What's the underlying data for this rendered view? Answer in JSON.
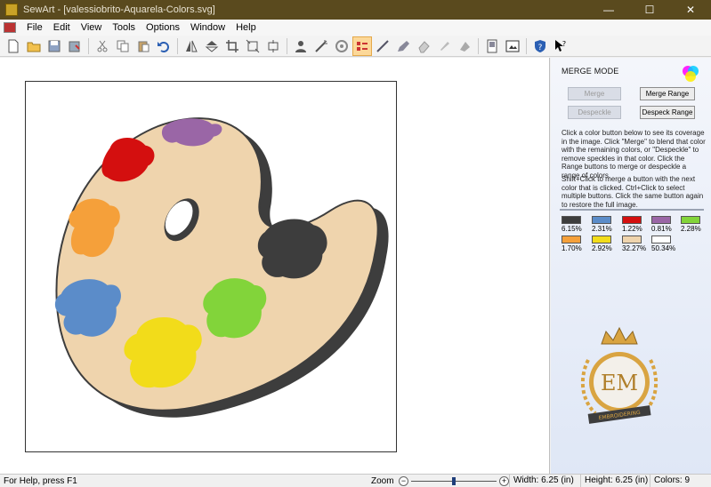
{
  "window": {
    "title": "SewArt - [valessiobrito-Aquarela-Colors.svg]",
    "minimize_glyph": "—",
    "maximize_glyph": "☐",
    "close_glyph": "✕"
  },
  "menu": [
    "File",
    "Edit",
    "View",
    "Tools",
    "Options",
    "Window",
    "Help"
  ],
  "toolbar_icons": [
    "new-file-icon",
    "open-folder-icon",
    "save-icon",
    "save-all-icon",
    "cut-icon",
    "copy-icon",
    "paste-icon",
    "undo-icon",
    "mirror-icon",
    "flip-icon",
    "crop-icon",
    "resize-icon",
    "rotate-icon",
    "person-icon",
    "wand-icon",
    "fill-icon",
    "merge-mode-icon",
    "line-icon",
    "pen-icon",
    "eraser-icon",
    "brush-icon",
    "shape-icon",
    "page-icon",
    "export-icon",
    "help-shield-icon",
    "whats-this-icon"
  ],
  "colors": {
    "titlebar": "#5a4a1e",
    "palette_body": "#efd4ad",
    "palette_shadow": "#3d3d3d"
  },
  "panel": {
    "title": "MERGE MODE",
    "merge": "Merge",
    "merge_range": "Merge Range",
    "despeckle": "Despeckle",
    "despeckle_range": "Despeck Range",
    "help1": "Click a color button below to see its coverage in the image. Click \"Merge\" to blend that color with the remaining colors, or \"Despeckle\" to remove speckles in that color. Click the Range buttons to merge or despeckle a range of colors.",
    "help2": "Shift+Click to merge a button with the next color that is clicked. Ctrl+Click to select multiple buttons. Click the same button again to restore the full image.",
    "swatches": [
      {
        "color": "#3d3d3d",
        "pct": "6.15%"
      },
      {
        "color": "#5b8cc9",
        "pct": "2.31%"
      },
      {
        "color": "#d40f0f",
        "pct": "1.22%"
      },
      {
        "color": "#9a66a6",
        "pct": "0.81%"
      },
      {
        "color": "#82d43a",
        "pct": "2.28%"
      },
      {
        "color": "#f5a03a",
        "pct": "1.70%"
      },
      {
        "color": "#f2dc1a",
        "pct": "2.92%"
      },
      {
        "color": "#efd4ad",
        "pct": "32.27%"
      },
      {
        "color": "#ffffff",
        "pct": "50.34%"
      }
    ],
    "logo_text": "EM",
    "logo_banner": "EMBROIDERING"
  },
  "status": {
    "help": "For Help, press F1",
    "zoom_label": "Zoom",
    "zoom_level": 0.5,
    "width": "Width:  6.25 (in)",
    "height": "Height:  6.25 (in)",
    "colors": "Colors:  9"
  }
}
